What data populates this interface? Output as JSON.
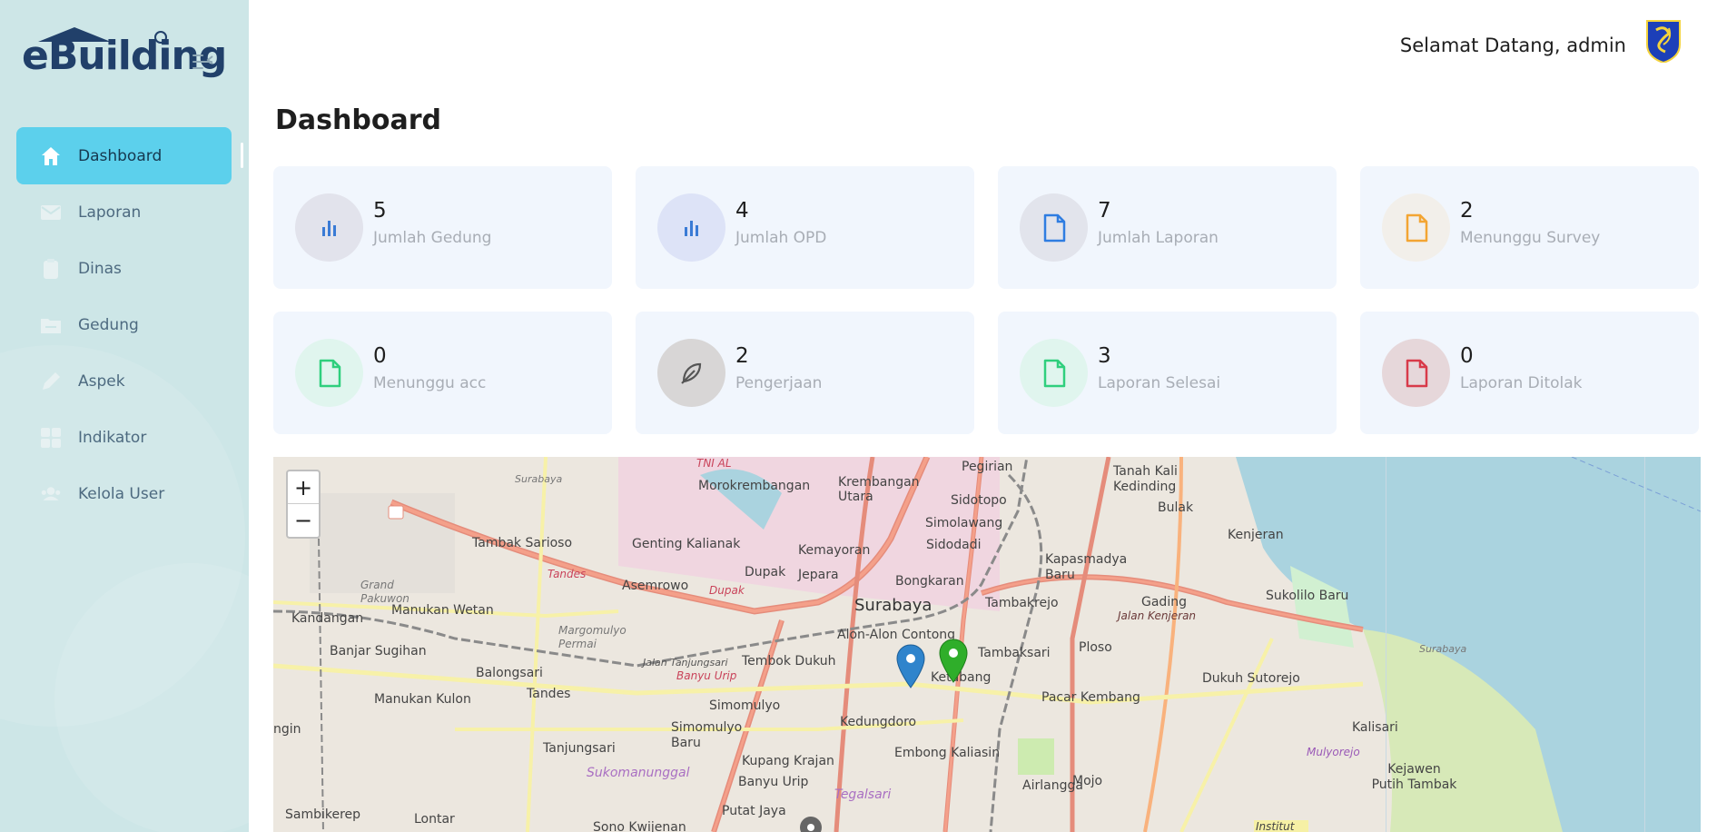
{
  "app": {
    "logo_text": "eBuilding"
  },
  "header": {
    "welcome": "Selamat Datang, admin"
  },
  "sidebar": {
    "items": [
      {
        "label": "Dashboard",
        "icon": "home-icon",
        "active": true
      },
      {
        "label": "Laporan",
        "icon": "mail-icon",
        "active": false
      },
      {
        "label": "Dinas",
        "icon": "clipboard-icon",
        "active": false
      },
      {
        "label": "Gedung",
        "icon": "folder-icon",
        "active": false
      },
      {
        "label": "Aspek",
        "icon": "pen-icon",
        "active": false
      },
      {
        "label": "Indikator",
        "icon": "grid-icon",
        "active": false
      },
      {
        "label": "Kelola User",
        "icon": "users-icon",
        "active": false
      }
    ]
  },
  "page": {
    "title": "Dashboard"
  },
  "cards": [
    {
      "value": "5",
      "label": "Jumlah Gedung",
      "icon": "bar-chart-icon",
      "color": "#3a7bd5",
      "bg": "#e2e3ec"
    },
    {
      "value": "4",
      "label": "Jumlah OPD",
      "icon": "bar-chart-icon",
      "color": "#3a7bd5",
      "bg": "#dde3f7"
    },
    {
      "value": "7",
      "label": "Jumlah Laporan",
      "icon": "file-icon",
      "color": "#2f7de1",
      "bg": "#e2e4ec"
    },
    {
      "value": "2",
      "label": "Menunggu Survey",
      "icon": "file-icon",
      "color": "#f3a533",
      "bg": "#f2efea"
    },
    {
      "value": "0",
      "label": "Menunggu acc",
      "icon": "file-icon",
      "color": "#2fcf7d",
      "bg": "#e0f5ee"
    },
    {
      "value": "2",
      "label": "Pengerjaan",
      "icon": "feather-icon",
      "color": "#555555",
      "bg": "#d8d6d6"
    },
    {
      "value": "3",
      "label": "Laporan Selesai",
      "icon": "file-icon",
      "color": "#2fcf7d",
      "bg": "#e0f5ee"
    },
    {
      "value": "0",
      "label": "Laporan Ditolak",
      "icon": "file-icon",
      "color": "#d83a4a",
      "bg": "#e6d7da"
    }
  ],
  "map": {
    "zoom_in": "+",
    "zoom_out": "−",
    "labels": [
      "TNI AL",
      "Surabaya",
      "Morokrembangan",
      "Krembangan Utara",
      "Pegirian",
      "Tanah Kali Kedinding",
      "Bulak",
      "Tambak Sarioso",
      "Genting Kalianak",
      "Sidotopo",
      "Simolawang",
      "Sidodadi",
      "Kenjeran",
      "Kemayoran",
      "Jepara",
      "Dupak",
      "Bongkaran",
      "Kapasmadya Baru",
      "Tandes",
      "Grand Pakuwon",
      "Manukan Wetan",
      "Asemrowo",
      "Dupak",
      "Surabaya",
      "Tambakrejo",
      "Gading",
      "Sukolilo Baru",
      "Kandangan",
      "Margomulyo Permai",
      "Alon-Alon Contong",
      "Jalan Kenjeran",
      "Banjar Sugihan",
      "Balongsari",
      "Tembok Dukuh",
      "Tambaksari",
      "Ploso",
      "Jalan Tanjungsari",
      "Banyu Urip",
      "Ketabang",
      "Dukuh Sutorejo",
      "Surabaya",
      "Manukan Kulon",
      "Tandes",
      "Simomulyo",
      "Pacar Kembang",
      "ngin",
      "Simomulyo Baru",
      "Kedungdoro",
      "Kalisari",
      "Tanjungsari",
      "Kupang Krajan",
      "Embong Kaliasin",
      "Mulyorejo",
      "Sukomanunggal",
      "Banyu Urip",
      "Airlangga",
      "Mojo",
      "Kejawen Putih Tambak",
      "Sambikerep",
      "Lontar",
      "Putat Jaya",
      "Tegalsari",
      "Sono Kwijenan",
      "Institut"
    ]
  }
}
